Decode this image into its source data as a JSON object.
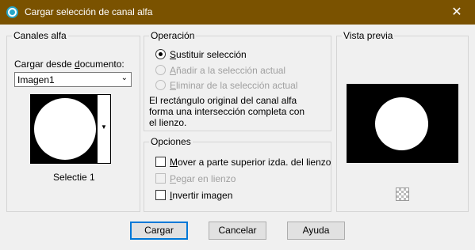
{
  "window": {
    "title": "Cargar selección de canal alfa",
    "close_glyph": "✕"
  },
  "canales": {
    "group_title": "Canales alfa",
    "load_label_pre": "Cargar desde ",
    "load_label_u": "d",
    "load_label_post": "ocumento:",
    "document_value": "Imagen1",
    "thumbnail_label": "Selectie 1"
  },
  "operacion": {
    "group_title": "Operación",
    "options": [
      {
        "u": "S",
        "rest": "ustituir selección",
        "checked": true,
        "enabled": true
      },
      {
        "u": "A",
        "rest": "ñadir a la selección actual",
        "checked": false,
        "enabled": false
      },
      {
        "u": "E",
        "rest": "liminar de la selección actual",
        "checked": false,
        "enabled": false
      }
    ],
    "info_line1": "El rectángulo original del canal alfa",
    "info_line2": "forma una intersección completa con",
    "info_line3": "el lienzo."
  },
  "opciones": {
    "group_title": "Opciones",
    "items": [
      {
        "u": "M",
        "rest": "over a parte superior izda. del lienzo",
        "checked": false,
        "enabled": true
      },
      {
        "u": "P",
        "rest": "egar en lienzo",
        "checked": false,
        "enabled": false
      },
      {
        "u": "I",
        "rest": "nvertir imagen",
        "checked": false,
        "enabled": true
      }
    ]
  },
  "preview": {
    "group_title": "Vista previa"
  },
  "buttons": {
    "ok": "Cargar",
    "cancel": "Cancelar",
    "help": "Ayuda"
  },
  "colors": {
    "titlebar": "#7a5200",
    "accent": "#0078d7"
  }
}
